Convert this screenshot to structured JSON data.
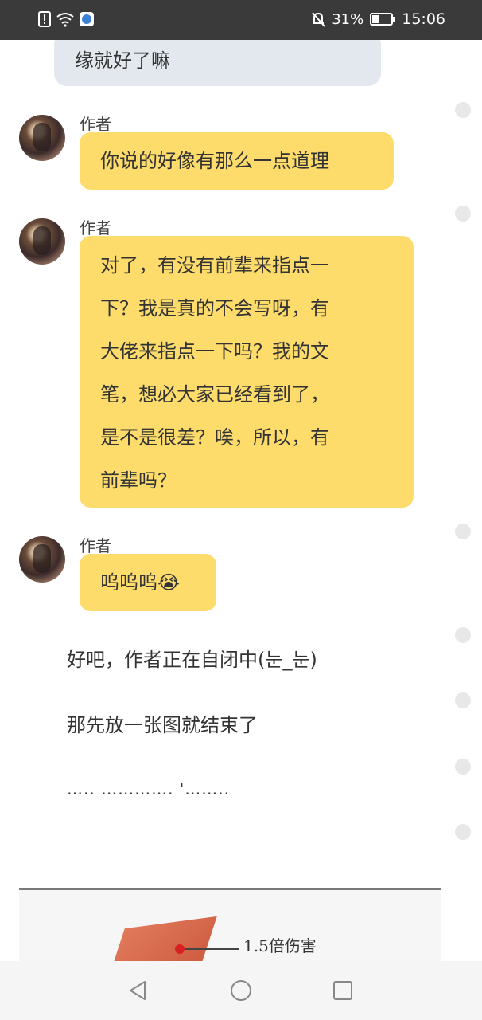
{
  "status_bar": {
    "battery_percent": "31%",
    "time": "15:06"
  },
  "messages": [
    {
      "type": "bubble",
      "text": "缘就好了嘛"
    },
    {
      "type": "author_bubble",
      "author": "作者",
      "lines": [
        "你说的好像有那么一点道理"
      ]
    },
    {
      "type": "author_bubble",
      "author": "作者",
      "lines": [
        "对了，有没有前辈来指点一",
        "下？我是真的不会写呀，有",
        "大佬来指点一下吗？我的文",
        "笔，想必大家已经看到了，",
        "是不是很差？唉，所以，有",
        "前辈吗？"
      ]
    },
    {
      "type": "author_bubble",
      "author": "作者",
      "lines": [
        "呜呜呜😭"
      ]
    }
  ],
  "narration": [
    "好吧，作者正在自闭中(눈_눈)",
    "那先放一张图就结束了",
    "….. …………. '…….."
  ],
  "image": {
    "caption": "1.5倍伤害"
  },
  "icons": {
    "status_left": [
      "alert-icon",
      "wifi-icon",
      "app-icon"
    ],
    "status_right": [
      "mute-bell-icon",
      "battery-icon"
    ],
    "nav": [
      "back-icon",
      "home-icon",
      "recents-icon"
    ]
  },
  "colors": {
    "status_bar": "#3a3a3a",
    "author_bubble": "#fddc6c",
    "reader_bubble": "#e3e8ef",
    "background": "#ffffff"
  }
}
